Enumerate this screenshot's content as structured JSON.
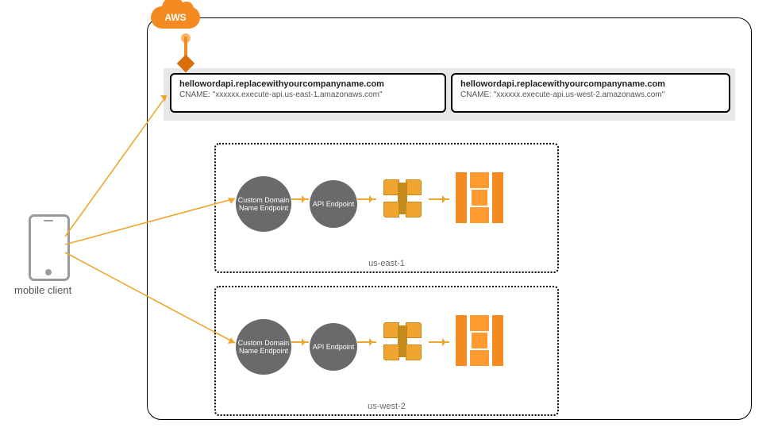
{
  "cloud": {
    "provider": "AWS"
  },
  "dns": {
    "left": {
      "domain": "hellowordapi.replacewithyourcompanyname.com",
      "cname": "CNAME: \"xxxxxx.execute-api.us-east-1.amazonaws.com\""
    },
    "right": {
      "domain": "hellowordapi.replacewithyourcompanyname.com",
      "cname": "CNAME: \"xxxxxx.execute-api.us-west-2.amazonaws.com\""
    }
  },
  "regions": {
    "r1": {
      "label": "us-east-1",
      "node1": "Custom Domain Name Endpoint",
      "node2": "API Endpoint"
    },
    "r2": {
      "label": "us-west-2",
      "node1": "Custom Domain Name Endpoint",
      "node2": "API Endpoint"
    }
  },
  "client": {
    "label": "mobile client"
  }
}
